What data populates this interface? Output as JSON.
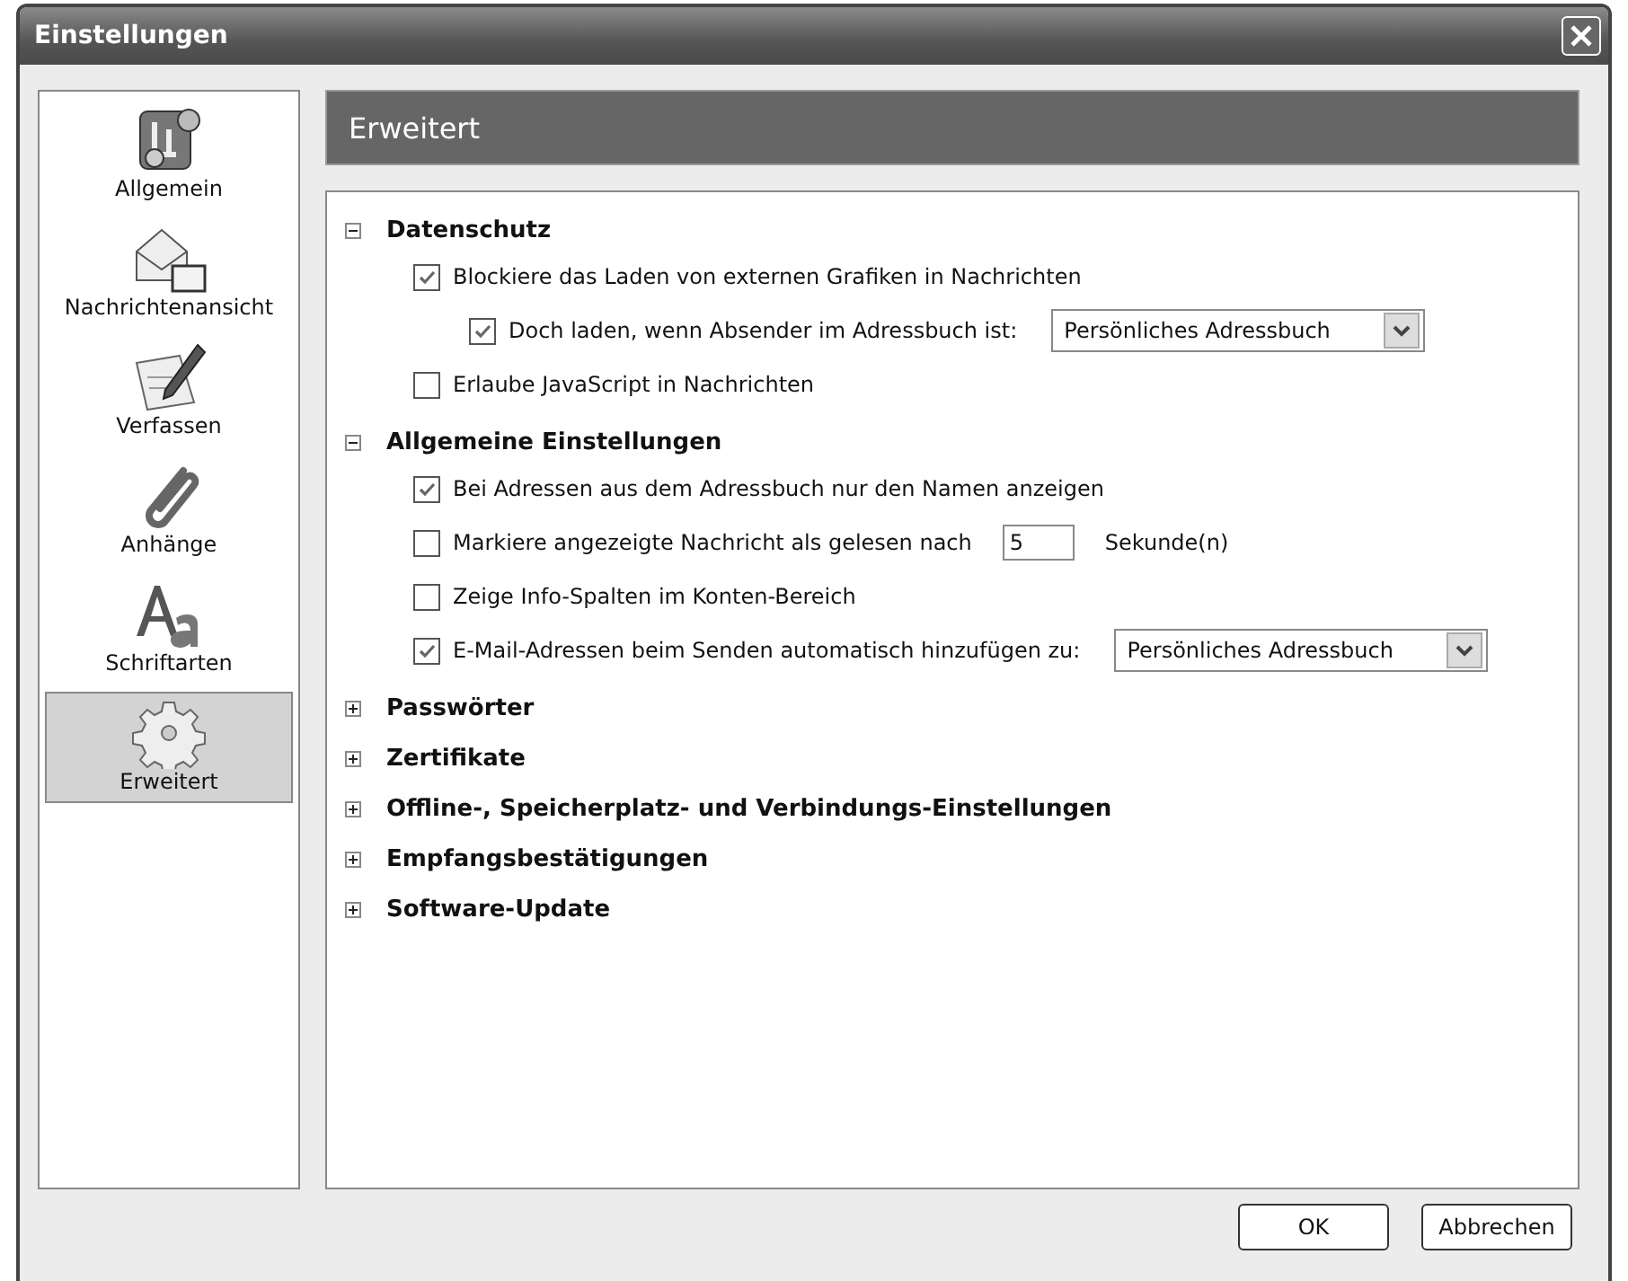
{
  "window": {
    "title": "Einstellungen"
  },
  "sidebar": {
    "items": [
      {
        "label": "Allgemein",
        "selected": false
      },
      {
        "label": "Nachrichtenansicht",
        "selected": false
      },
      {
        "label": "Verfassen",
        "selected": false
      },
      {
        "label": "Anhänge",
        "selected": false
      },
      {
        "label": "Schriftarten",
        "selected": false
      },
      {
        "label": "Erweitert",
        "selected": true
      }
    ]
  },
  "header": "Erweitert",
  "sections": [
    {
      "title": "Datenschutz",
      "expanded": true,
      "items": [
        {
          "kind": "checkbox",
          "label": "Blockiere das Laden von externen Grafiken in Nachrichten",
          "checked": true,
          "children": [
            {
              "kind": "select",
              "label": "Doch laden, wenn Absender im Adressbuch ist:",
              "checked": true,
              "value": "Persönliches Adressbuch"
            }
          ]
        },
        {
          "kind": "checkbox",
          "label": "Erlaube JavaScript in Nachrichten",
          "checked": false
        }
      ]
    },
    {
      "title": "Allgemeine Einstellungen",
      "expanded": true,
      "items": [
        {
          "kind": "checkbox",
          "label": "Bei Adressen aus dem Adressbuch nur den Namen anzeigen",
          "checked": true
        },
        {
          "kind": "number",
          "label": "Markiere angezeigte Nachricht als gelesen nach",
          "checked": false,
          "value": "5",
          "unit": "Sekunde(n)"
        },
        {
          "kind": "checkbox",
          "label": "Zeige Info-Spalten im Konten-Bereich",
          "checked": false
        },
        {
          "kind": "select",
          "label": "E-Mail-Adressen beim Senden automatisch hinzufügen zu:",
          "checked": true,
          "value": "Persönliches Adressbuch"
        }
      ]
    },
    {
      "title": "Passwörter",
      "expanded": false
    },
    {
      "title": "Zertifikate",
      "expanded": false
    },
    {
      "title": "Offline-, Speicherplatz- und Verbindungs-Einstellungen",
      "expanded": false
    },
    {
      "title": "Empfangsbestätigungen",
      "expanded": false
    },
    {
      "title": "Software-Update",
      "expanded": false
    }
  ],
  "buttons": [
    "OK",
    "Abbrechen"
  ]
}
